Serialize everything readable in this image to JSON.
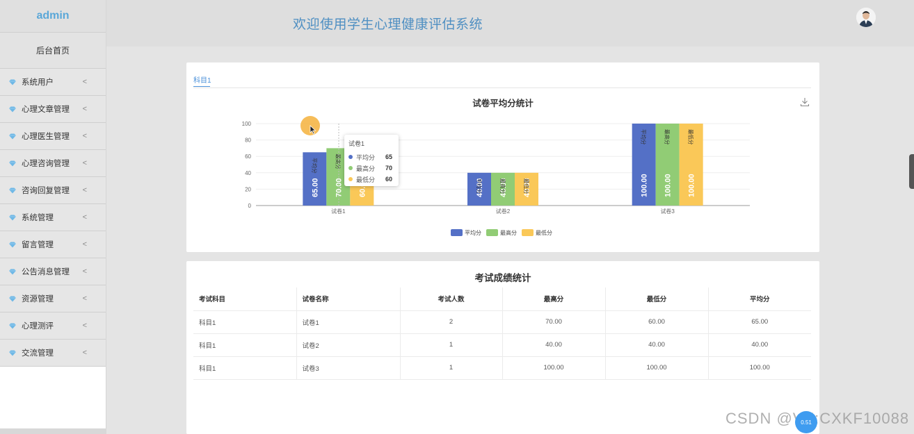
{
  "sidebar": {
    "brand": "admin",
    "home": "后台首页",
    "items": [
      {
        "label": "系统用户"
      },
      {
        "label": "心理文章管理"
      },
      {
        "label": "心理医生管理"
      },
      {
        "label": "心理咨询管理"
      },
      {
        "label": "咨询回复管理"
      },
      {
        "label": "系统管理"
      },
      {
        "label": "留言管理"
      },
      {
        "label": "公告消息管理"
      },
      {
        "label": "资源管理"
      },
      {
        "label": "心理测评"
      },
      {
        "label": "交流管理"
      }
    ],
    "chevron": "<",
    "item_icon": "diamond-icon"
  },
  "header": {
    "title": "欢迎使用学生心理健康评估系统",
    "avatar_icon": "user-avatar"
  },
  "chart_card": {
    "tab": "科目1",
    "download_icon": "download-icon"
  },
  "chart_data": {
    "type": "bar",
    "title": "试卷平均分统计",
    "categories": [
      "试卷1",
      "试卷2",
      "试卷3"
    ],
    "series": [
      {
        "name": "平均分",
        "values": [
          65.0,
          40.0,
          100.0
        ],
        "color": "#5470c6"
      },
      {
        "name": "最高分",
        "values": [
          70.0,
          40.0,
          100.0
        ],
        "color": "#91cc75"
      },
      {
        "name": "最低分",
        "values": [
          60.0,
          40.0,
          100.0
        ],
        "color": "#fac858"
      }
    ],
    "y_ticks": [
      "0",
      "20",
      "40",
      "60",
      "80",
      "100"
    ],
    "ylim": [
      0,
      100
    ],
    "grid": true,
    "legend_position": "bottom-center",
    "data_labels": "vertical-inside"
  },
  "tooltip": {
    "title": "试卷1",
    "rows": [
      {
        "label": "平均分",
        "value": "65"
      },
      {
        "label": "最高分",
        "value": "70"
      },
      {
        "label": "最低分",
        "value": "60"
      }
    ]
  },
  "table": {
    "title": "考试成绩统计",
    "headers": [
      "考试科目",
      "试卷名称",
      "考试人数",
      "最高分",
      "最低分",
      "平均分"
    ],
    "rows": [
      [
        "科目1",
        "试卷1",
        "2",
        "70.00",
        "60.00",
        "65.00"
      ],
      [
        "科目1",
        "试卷2",
        "1",
        "40.00",
        "40.00",
        "40.00"
      ],
      [
        "科目1",
        "试卷3",
        "1",
        "100.00",
        "100.00",
        "100.00"
      ]
    ]
  },
  "overlay": {
    "watermark": "CSDN @VX:CXKF10088",
    "float_button": "0.51"
  }
}
